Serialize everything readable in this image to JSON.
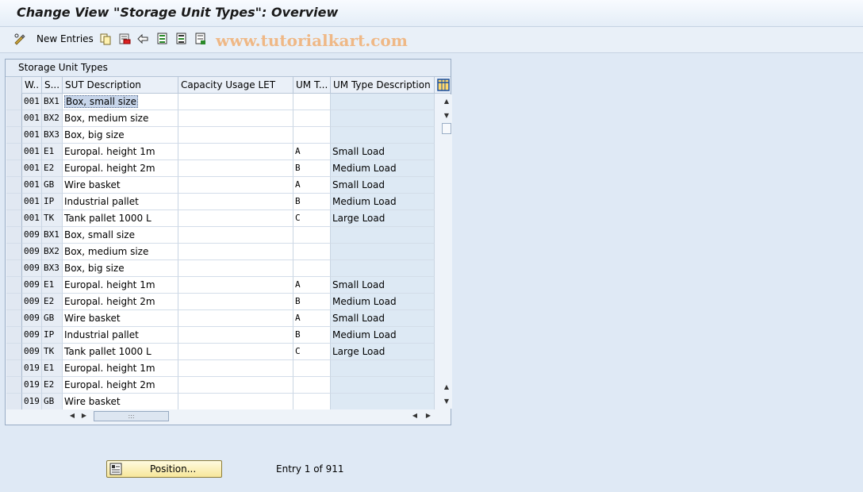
{
  "title": "Change View \"Storage Unit Types\": Overview",
  "toolbar": {
    "new_entries_label": "New Entries",
    "watermark": "www.tutorialkart.com",
    "icons": [
      "edit-glasses-icon",
      "copy-icon",
      "delete-icon",
      "undo-icon",
      "select-all-icon",
      "select-block-icon",
      "deselect-all-icon"
    ]
  },
  "panel": {
    "title": "Storage Unit Types",
    "columns": [
      "W..",
      "S...",
      "SUT Description",
      "Capacity Usage LET",
      "UM T...",
      "UM Type Description"
    ]
  },
  "rows": [
    {
      "w": "001",
      "s": "BX1",
      "desc": "Box, small size",
      "cap": "",
      "umt": "",
      "umdesc": ""
    },
    {
      "w": "001",
      "s": "BX2",
      "desc": "Box, medium size",
      "cap": "",
      "umt": "",
      "umdesc": ""
    },
    {
      "w": "001",
      "s": "BX3",
      "desc": "Box, big size",
      "cap": "",
      "umt": "",
      "umdesc": ""
    },
    {
      "w": "001",
      "s": "E1",
      "desc": "Europal. height 1m",
      "cap": "",
      "umt": "A",
      "umdesc": "Small Load"
    },
    {
      "w": "001",
      "s": "E2",
      "desc": "Europal. height 2m",
      "cap": "",
      "umt": "B",
      "umdesc": "Medium Load"
    },
    {
      "w": "001",
      "s": "GB",
      "desc": "Wire basket",
      "cap": "",
      "umt": "A",
      "umdesc": "Small Load"
    },
    {
      "w": "001",
      "s": "IP",
      "desc": "Industrial pallet",
      "cap": "",
      "umt": "B",
      "umdesc": "Medium Load"
    },
    {
      "w": "001",
      "s": "TK",
      "desc": "Tank pallet 1000 L",
      "cap": "",
      "umt": "C",
      "umdesc": "Large Load"
    },
    {
      "w": "009",
      "s": "BX1",
      "desc": "Box, small size",
      "cap": "",
      "umt": "",
      "umdesc": ""
    },
    {
      "w": "009",
      "s": "BX2",
      "desc": "Box, medium size",
      "cap": "",
      "umt": "",
      "umdesc": ""
    },
    {
      "w": "009",
      "s": "BX3",
      "desc": "Box, big size",
      "cap": "",
      "umt": "",
      "umdesc": ""
    },
    {
      "w": "009",
      "s": "E1",
      "desc": "Europal. height 1m",
      "cap": "",
      "umt": "A",
      "umdesc": "Small Load"
    },
    {
      "w": "009",
      "s": "E2",
      "desc": "Europal. height 2m",
      "cap": "",
      "umt": "B",
      "umdesc": "Medium Load"
    },
    {
      "w": "009",
      "s": "GB",
      "desc": "Wire basket",
      "cap": "",
      "umt": "A",
      "umdesc": "Small Load"
    },
    {
      "w": "009",
      "s": "IP",
      "desc": "Industrial pallet",
      "cap": "",
      "umt": "B",
      "umdesc": "Medium Load"
    },
    {
      "w": "009",
      "s": "TK",
      "desc": "Tank pallet 1000 L",
      "cap": "",
      "umt": "C",
      "umdesc": "Large Load"
    },
    {
      "w": "019",
      "s": "E1",
      "desc": "Europal. height 1m",
      "cap": "",
      "umt": "",
      "umdesc": ""
    },
    {
      "w": "019",
      "s": "E2",
      "desc": "Europal. height 2m",
      "cap": "",
      "umt": "",
      "umdesc": ""
    },
    {
      "w": "019",
      "s": "GB",
      "desc": "Wire basket",
      "cap": "",
      "umt": "",
      "umdesc": ""
    }
  ],
  "footer": {
    "position_label": "Position...",
    "entry_info": "Entry 1 of 911"
  }
}
